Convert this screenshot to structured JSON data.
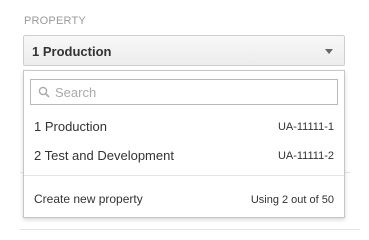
{
  "property": {
    "section_label": "PROPERTY",
    "selected": "1 Production"
  },
  "dropdown": {
    "search_placeholder": "Search",
    "search_value": "",
    "options": [
      {
        "name": "1 Production",
        "id": "UA-11111-1"
      },
      {
        "name": "2 Test and Development",
        "id": "UA-11111-2"
      }
    ],
    "create_label": "Create new property",
    "usage_text": "Using 2 out of 50"
  },
  "icons": {
    "search": "search-icon",
    "caret": "chevron-down-icon"
  },
  "colors": {
    "border": "#c6c6c6",
    "label_gray": "#999999",
    "text": "#333333"
  }
}
